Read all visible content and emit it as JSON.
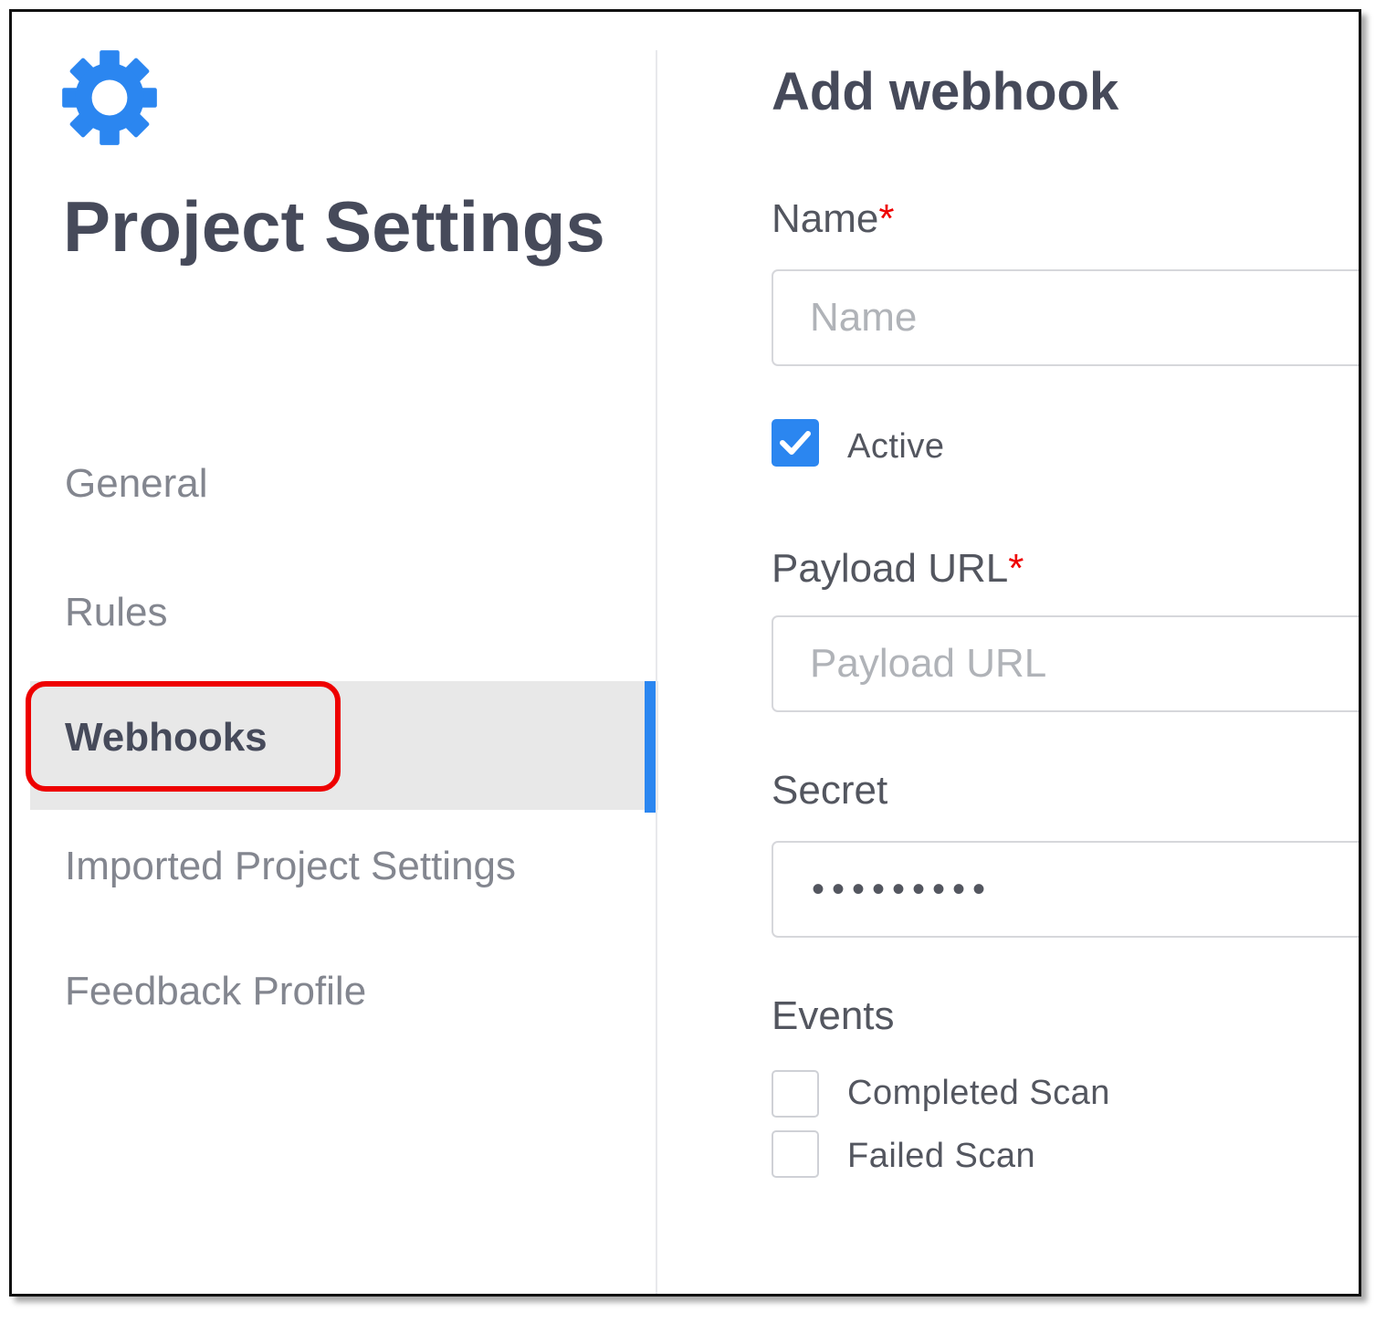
{
  "sidebar": {
    "title": "Project Settings",
    "items": [
      {
        "label": "General",
        "active": false
      },
      {
        "label": "Rules",
        "active": false
      },
      {
        "label": "Webhooks",
        "active": true
      },
      {
        "label": "Imported Project Settings",
        "active": false
      },
      {
        "label": "Feedback Profile",
        "active": false
      }
    ]
  },
  "form": {
    "title": "Add webhook",
    "name": {
      "label": "Name",
      "required_mark": "*",
      "placeholder": "Name",
      "value": ""
    },
    "active": {
      "label": "Active",
      "checked": true
    },
    "payload_url": {
      "label": "Payload URL",
      "required_mark": "*",
      "placeholder": "Payload URL",
      "value": ""
    },
    "secret": {
      "label": "Secret",
      "value": "•••••••••"
    },
    "events": {
      "label": "Events",
      "options": [
        {
          "label": "Completed Scan",
          "checked": false
        },
        {
          "label": "Failed Scan",
          "checked": false
        }
      ]
    }
  },
  "colors": {
    "accent": "#2b86f0",
    "highlight": "#ee0000",
    "heading": "#464a5a",
    "muted": "#83868f"
  },
  "icons": {
    "header": "gear-icon",
    "checkbox_checked": "checkmark-icon"
  }
}
